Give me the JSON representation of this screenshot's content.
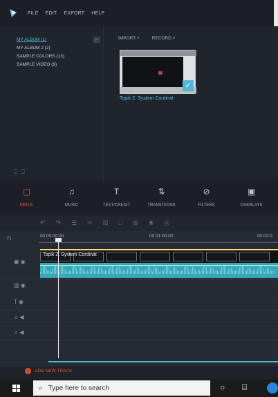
{
  "menu": [
    "FILE",
    "EDIT",
    "EXPORT",
    "HELP"
  ],
  "library": {
    "items": [
      "MY ALBUM (1)",
      "MY ALBUM 2 (2)",
      "SAMPLE COLORS (13)",
      "SAMPLE VIDEO (9)"
    ],
    "collapse_label": "←"
  },
  "media": {
    "import_label": "IMPORT ˅",
    "record_label": "RECORD ˅",
    "clip_name": "Topik 2. System Cordinat"
  },
  "tabs": [
    {
      "label": "MEDIA",
      "icon": "folder-icon",
      "glyph": "▢"
    },
    {
      "label": "MUSIC",
      "icon": "music-icon",
      "glyph": "♫"
    },
    {
      "label": "TEXT/CREDIT",
      "icon": "text-icon",
      "glyph": "T"
    },
    {
      "label": "TRANSITIONS",
      "icon": "transitions-icon",
      "glyph": "⇅"
    },
    {
      "label": "FILTERS",
      "icon": "filters-icon",
      "glyph": "⊘"
    },
    {
      "label": "OVERLAYS",
      "icon": "overlays-icon",
      "glyph": "▣"
    }
  ],
  "timeline": {
    "ruler": [
      "00:00:00:00",
      "00:01:00:00",
      "00:02:0"
    ],
    "clip_label": "Topik 2. System Cordinat",
    "add_track": "ADD NEW TRACK"
  },
  "taskbar": {
    "search_placeholder": "Type here to search"
  },
  "colors": {
    "accent": "#e0533e",
    "highlight": "#59b8e6",
    "audio": "#3aa7b6"
  }
}
